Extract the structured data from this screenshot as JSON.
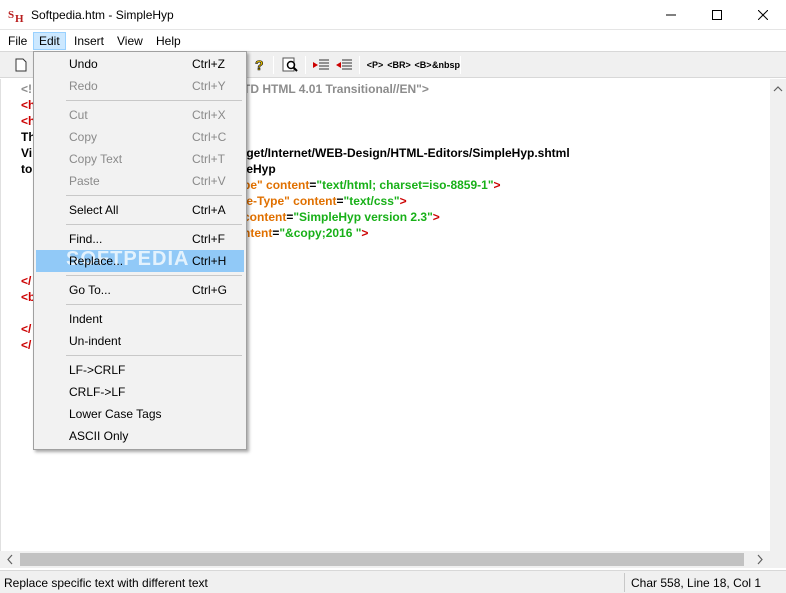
{
  "window": {
    "title": "Softpedia.htm - SimpleHyp",
    "icon_text": "SH"
  },
  "menubar": {
    "items": [
      {
        "label": "File"
      },
      {
        "label": "Edit"
      },
      {
        "label": "Insert"
      },
      {
        "label": "View"
      },
      {
        "label": "Help"
      }
    ]
  },
  "toolbar": {
    "tag_buttons": [
      "<P>",
      "<BR>",
      "<B>",
      "&nbsp"
    ]
  },
  "editor": {
    "lines": [
      {
        "prefix": "<!",
        "visible": "TD HTML 4.01 Transitional//EN\">"
      },
      {
        "prefix": "<h",
        "visible": ""
      },
      {
        "prefix": "<h",
        "visible": ""
      },
      {
        "prefix": "Th",
        "visible": ""
      },
      {
        "prefix": "Vi",
        "visible": "/get/Internet/WEB-Design/HTML-Editors/SimpleHyp.shtml"
      },
      {
        "prefix": "to",
        "visible": "leHyp"
      },
      {
        "prefix": "",
        "attr_pre": "pe\"",
        "attr": "content",
        "val": "\"text/html; charset=iso-8859-1\"",
        "end": ">"
      },
      {
        "prefix": "",
        "attr_pre": "le-Type\"",
        "attr": "content",
        "val": "\"text/css\"",
        "end": ">"
      },
      {
        "prefix": "",
        "attr": "content",
        "val": "\"SimpleHyp version 2.3\"",
        "end": ">"
      },
      {
        "prefix": "",
        "attr": "ntent",
        "val": "\"&copy;2016 \"",
        "end": ">"
      },
      {
        "prefix": "</",
        "visible": ""
      },
      {
        "prefix": "<b",
        "visible": ""
      },
      {
        "prefix": "</",
        "visible": ""
      },
      {
        "prefix": "</",
        "visible": ""
      }
    ]
  },
  "edit_menu": {
    "items": [
      {
        "label": "Undo",
        "shortcut": "Ctrl+Z",
        "disabled": false
      },
      {
        "label": "Redo",
        "shortcut": "Ctrl+Y",
        "disabled": true
      },
      {
        "label": "Cut",
        "shortcut": "Ctrl+X",
        "disabled": true
      },
      {
        "label": "Copy",
        "shortcut": "Ctrl+C",
        "disabled": true
      },
      {
        "label": "Copy Text",
        "shortcut": "Ctrl+T",
        "disabled": true
      },
      {
        "label": "Paste",
        "shortcut": "Ctrl+V",
        "disabled": true
      },
      {
        "label": "Select All",
        "shortcut": "Ctrl+A",
        "disabled": false
      },
      {
        "label": "Find...",
        "shortcut": "Ctrl+F",
        "disabled": false
      },
      {
        "label": "Replace...",
        "shortcut": "Ctrl+H",
        "disabled": false,
        "highlighted": true
      },
      {
        "label": "Go To...",
        "shortcut": "Ctrl+G",
        "disabled": false
      },
      {
        "label": "Indent",
        "shortcut": "",
        "disabled": false
      },
      {
        "label": "Un-indent",
        "shortcut": "",
        "disabled": false
      },
      {
        "label": "LF->CRLF",
        "shortcut": "",
        "disabled": false
      },
      {
        "label": "CRLF->LF",
        "shortcut": "",
        "disabled": false
      },
      {
        "label": "Lower Case Tags",
        "shortcut": "",
        "disabled": false
      },
      {
        "label": "ASCII Only",
        "shortcut": "",
        "disabled": false
      }
    ],
    "watermark": "SOFTPEDIA"
  },
  "statusbar": {
    "message": "Replace specific text with different text",
    "position": "Char 558, Line 18, Col 1"
  }
}
